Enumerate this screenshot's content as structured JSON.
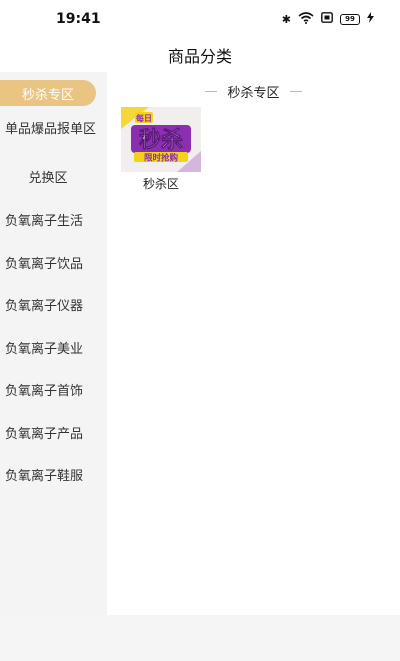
{
  "status_bar": {
    "time": "19:41",
    "icons": [
      "bluetooth-icon",
      "wifi-icon",
      "screen-icon",
      "battery-icon",
      "charging-icon"
    ],
    "battery_level": "99"
  },
  "header": {
    "title": "商品分类"
  },
  "sidebar": {
    "items": [
      {
        "label": "秒杀专区",
        "active": true
      },
      {
        "label": "单品爆品报单区"
      },
      {
        "label": "兑换区"
      },
      {
        "label": "负氧离子生活"
      },
      {
        "label": "负氧离子饮品"
      },
      {
        "label": "负氧离子仪器"
      },
      {
        "label": "负氧离子美业"
      },
      {
        "label": "负氧离子首饰"
      },
      {
        "label": "负氧离子产品"
      },
      {
        "label": "负氧离子鞋服"
      }
    ]
  },
  "content": {
    "section_title": "秒杀专区",
    "tiles": [
      {
        "label": "秒杀区",
        "image_text_top": "每日",
        "image_text_main": "秒杀",
        "image_text_bottom": "限时抢购"
      }
    ]
  },
  "colors": {
    "accent": "#e9c483",
    "promo_purple": "#8a2fb0",
    "promo_yellow": "#f4d21a"
  }
}
